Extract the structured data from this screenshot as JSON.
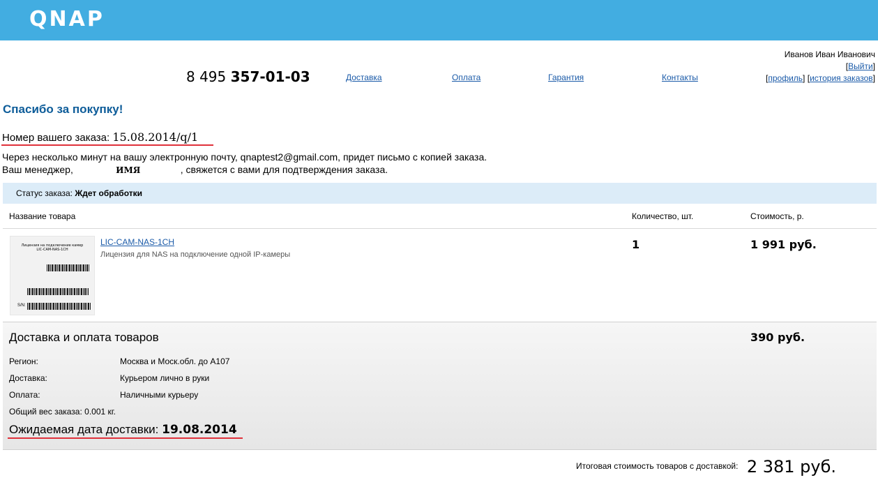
{
  "header": {
    "logo": "QNAP",
    "brand_color": "#42ade1"
  },
  "user": {
    "name": "Иванов Иван Иванович",
    "logout": "Выйти",
    "profile": "профиль",
    "history": "история заказов"
  },
  "phone": {
    "prefix": "8 495",
    "number": "357-01-03"
  },
  "nav": [
    "Доставка",
    "Оплата",
    "Гарантия",
    "Контакты"
  ],
  "thanks": "Спасибо за покупку!",
  "order": {
    "label": "Номер вашего заказа:",
    "number": "15.08.2014/q/1"
  },
  "message": {
    "line1": "Через несколько минут на вашу электронную почту, qnaptest2@gmail.com, придет письмо с копией заказа.",
    "manager_prefix": "Ваш менеджер,",
    "manager_name": "ИМЯ",
    "manager_suffix": ", свяжется с вами для подтверждения заказа."
  },
  "status": {
    "label": "Статус заказа:",
    "value": "Ждет обработки"
  },
  "table": {
    "columns": [
      "Название товара",
      "Количество, шт.",
      "Стоимость, р."
    ],
    "item": {
      "image_caption_1": "Лицензия на подключение камер",
      "image_caption_2": "LIC-CAM-NAS-1CH",
      "image_sn": "S/N:",
      "name": "LIC-CAM-NAS-1CH",
      "description": "Лицензия для NAS на подключение одной IP-камеры",
      "quantity": "1",
      "price": "1 991 руб."
    }
  },
  "delivery": {
    "title": "Доставка и оплата товаров",
    "price": "390 руб.",
    "rows": [
      {
        "label": "Регион:",
        "value": "Москва и Моск.обл. до А107"
      },
      {
        "label": "Доставка:",
        "value": "Курьером лично в руки"
      },
      {
        "label": "Оплата:",
        "value": "Наличными курьеру"
      }
    ],
    "weight": "Общий вес заказа: 0.001 кг.",
    "eta_label": "Ожидаемая дата доставки:",
    "eta_date": "19.08.2014"
  },
  "total": {
    "label": "Итоговая стоимость товаров с доставкой:",
    "amount": "2 381 руб."
  }
}
